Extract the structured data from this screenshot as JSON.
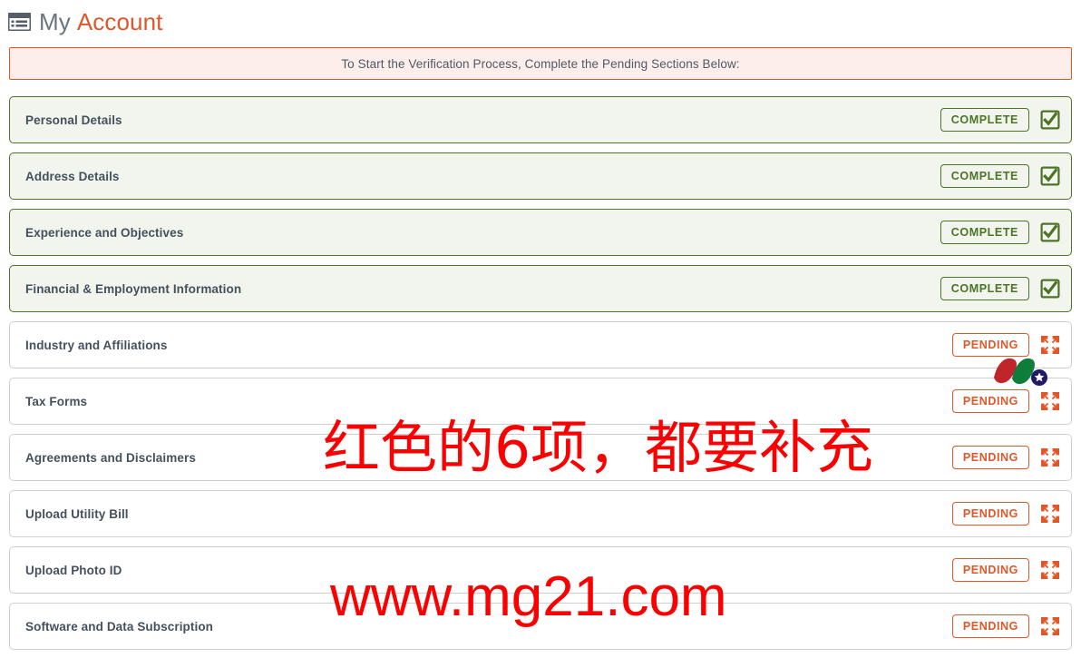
{
  "header": {
    "icon": "list-icon",
    "title_primary": "My",
    "title_secondary": "Account"
  },
  "alert": {
    "message": "To Start the Verification Process, Complete the Pending Sections Below:",
    "border_color": "#dd5a26",
    "background_color": "#fdeeeb"
  },
  "status_labels": {
    "complete": "COMPLETE",
    "pending": "PENDING"
  },
  "colors": {
    "complete_green": "#4c7326",
    "pending_orange": "#e0572a",
    "accent_orange": "#e0562a",
    "label_gray": "#44515c",
    "watermark_red": "#fa0000"
  },
  "sections": [
    {
      "label": "Personal Details",
      "status": "COMPLETE",
      "state": "complete",
      "icon": "checkbox-checked-icon"
    },
    {
      "label": "Address Details",
      "status": "COMPLETE",
      "state": "complete",
      "icon": "checkbox-checked-icon"
    },
    {
      "label": "Experience and Objectives",
      "status": "COMPLETE",
      "state": "complete",
      "icon": "checkbox-checked-icon"
    },
    {
      "label": "Financial & Employment Information",
      "status": "COMPLETE",
      "state": "complete",
      "icon": "checkbox-checked-icon"
    },
    {
      "label": "Industry and Affiliations",
      "status": "PENDING",
      "state": "pending",
      "icon": "expand-arrows-icon"
    },
    {
      "label": "Tax Forms",
      "status": "PENDING",
      "state": "pending",
      "icon": "expand-arrows-icon"
    },
    {
      "label": "Agreements and Disclaimers",
      "status": "PENDING",
      "state": "pending",
      "icon": "expand-arrows-icon"
    },
    {
      "label": "Upload Utility Bill",
      "status": "PENDING",
      "state": "pending",
      "icon": "expand-arrows-icon"
    },
    {
      "label": "Upload Photo ID",
      "status": "PENDING",
      "state": "pending",
      "icon": "expand-arrows-icon"
    },
    {
      "label": "Software and Data Subscription",
      "status": "PENDING",
      "state": "pending",
      "icon": "expand-arrows-icon"
    }
  ],
  "watermarks": {
    "chinese_note": "红色的6项，都要补充",
    "website": "www.mg21.com",
    "logo": "ribbon-logo-watermark"
  }
}
